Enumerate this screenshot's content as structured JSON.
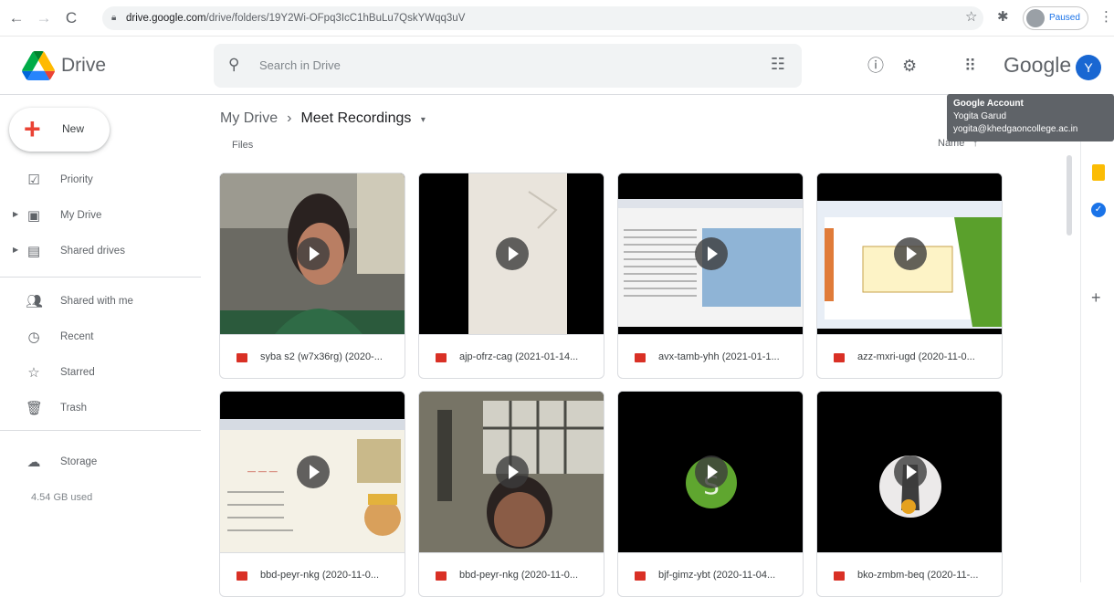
{
  "browser": {
    "back": "←",
    "forward": "→",
    "reload": "C",
    "url_host": "drive.google.com",
    "url_path": "/drive/folders/19Y2Wi-OFpq3IcC1hBuLu7QskYWqq3uV",
    "profile_status": "Paused"
  },
  "header": {
    "product": "Drive",
    "search_placeholder": "Search in Drive",
    "google_word": "Google",
    "avatar_letter": "Y"
  },
  "tooltip": {
    "title": "Google Account",
    "name": "Yogita Garud",
    "email": "yogita@khedgaoncollege.ac.in"
  },
  "sidebar": {
    "new_label": "New",
    "items": [
      {
        "label": "Priority",
        "icon": "priority-icon"
      },
      {
        "label": "My Drive",
        "icon": "my-drive-icon"
      },
      {
        "label": "Shared drives",
        "icon": "shared-drives-icon"
      },
      {
        "label": "Shared with me",
        "icon": "shared-with-me-icon"
      },
      {
        "label": "Recent",
        "icon": "clock-icon"
      },
      {
        "label": "Starred",
        "icon": "star-icon"
      },
      {
        "label": "Trash",
        "icon": "trash-icon"
      },
      {
        "label": "Storage",
        "icon": "cloud-icon"
      }
    ],
    "storage_used": "4.54 GB used"
  },
  "main": {
    "breadcrumb_root": "My Drive",
    "breadcrumb_current": "Meet Recordings",
    "files_label": "Files",
    "sort_label": "Name",
    "files": [
      {
        "name": "syba s2 (w7x36rg) (2020-..."
      },
      {
        "name": "ajp-ofrz-cag (2021-01-14..."
      },
      {
        "name": "avx-tamb-yhh (2021-01-1..."
      },
      {
        "name": "azz-mxri-ugd (2020-11-0..."
      },
      {
        "name": "bbd-peyr-nkg (2020-11-0..."
      },
      {
        "name": "bbd-peyr-nkg (2020-11-0..."
      },
      {
        "name": "bjf-gimz-ybt (2020-11-04..."
      },
      {
        "name": "bko-zmbm-beq (2020-11-..."
      }
    ]
  },
  "colors": {
    "accent": "#1a73e8",
    "video_icon": "#d93025"
  }
}
